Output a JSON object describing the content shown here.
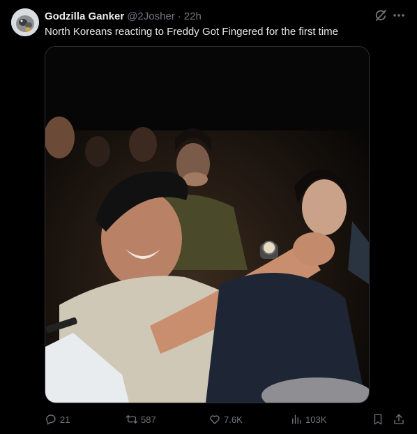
{
  "tweet": {
    "author": {
      "display_name": "Godzilla Ganker",
      "handle": "@2Josher",
      "avatar": "avatar"
    },
    "separator": "·",
    "timestamp": "22h",
    "text": "North Koreans reacting to Freddy Got Fingered for the first time",
    "header_icons": [
      "grok-icon",
      "more-icon"
    ],
    "media": {
      "kind": "photo",
      "subject": "audience laughing in a dark cinema"
    },
    "actions": {
      "reply": {
        "icon": "reply-icon",
        "count": "21"
      },
      "retweet": {
        "icon": "retweet-icon",
        "count": "587"
      },
      "like": {
        "icon": "heart-icon",
        "count": "7.6K"
      },
      "views": {
        "icon": "views-icon",
        "count": "103K"
      },
      "bookmark": {
        "icon": "bookmark-icon"
      },
      "share": {
        "icon": "share-icon"
      }
    }
  },
  "colors": {
    "background": "#000000",
    "text_primary": "#e7e9ea",
    "text_secondary": "#71767b",
    "border": "#2f3336"
  }
}
